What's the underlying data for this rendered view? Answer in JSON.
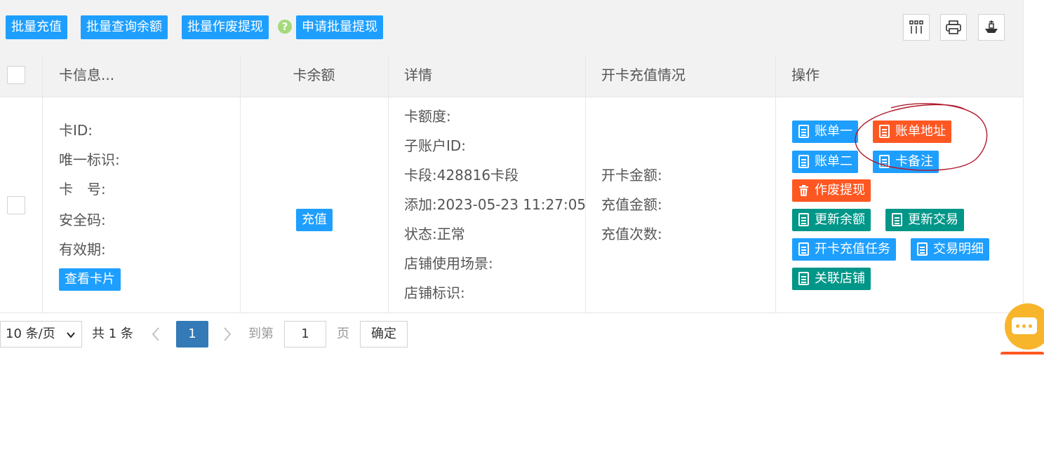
{
  "toolbar": {
    "buttons": [
      "批量充值",
      "批量查询余额",
      "批量作废提现",
      "申请批量提现"
    ],
    "help_glyph": "?",
    "icons": [
      "columns-icon",
      "print-icon",
      "export-icon"
    ]
  },
  "table": {
    "headers": {
      "card_info": "卡信息...",
      "balance": "卡余额",
      "details": "详情",
      "open_recharge": "开卡充值情况",
      "actions": "操作"
    },
    "row": {
      "card_info": {
        "card_id": "卡ID:",
        "unique_id": "唯一标识:",
        "card_no": "卡　号:",
        "security_code": "安全码:",
        "expiry": "有效期:",
        "view_card_button": "查看卡片"
      },
      "recharge_button": "充值",
      "details": {
        "limit": "卡额度:",
        "sub_account": "子账户ID:",
        "segment": "卡段:428816卡段",
        "added": "添加:2023-05-23 11:27:05",
        "status": "状态:正常",
        "scene": "店铺使用场景:",
        "store_tag": "店铺标识:"
      },
      "open_recharge": {
        "open_amount": "开卡金额:",
        "recharge_amount": "充值金额:",
        "recharge_count": "充值次数:"
      },
      "actions": {
        "bill_one": "账单一",
        "bill_address": "账单地址",
        "bill_two": "账单二",
        "card_note": "卡备注",
        "void_withdraw": "作废提现",
        "update_balance": "更新余额",
        "update_trade": "更新交易",
        "open_recharge_task": "开卡充值任务",
        "trade_detail": "交易明细",
        "link_store": "关联店铺"
      }
    }
  },
  "pagination": {
    "page_size": "10 条/页",
    "total": "共 1 条",
    "current_page": "1",
    "goto_label": "到第",
    "goto_value": "1",
    "page_unit": "页",
    "confirm": "确定"
  },
  "colors": {
    "primary": "#1e9fff",
    "danger": "#ff5722",
    "success": "#009688",
    "page_active": "#337ab7",
    "chat": "#f7b52c",
    "annotation": "#b0182b"
  }
}
